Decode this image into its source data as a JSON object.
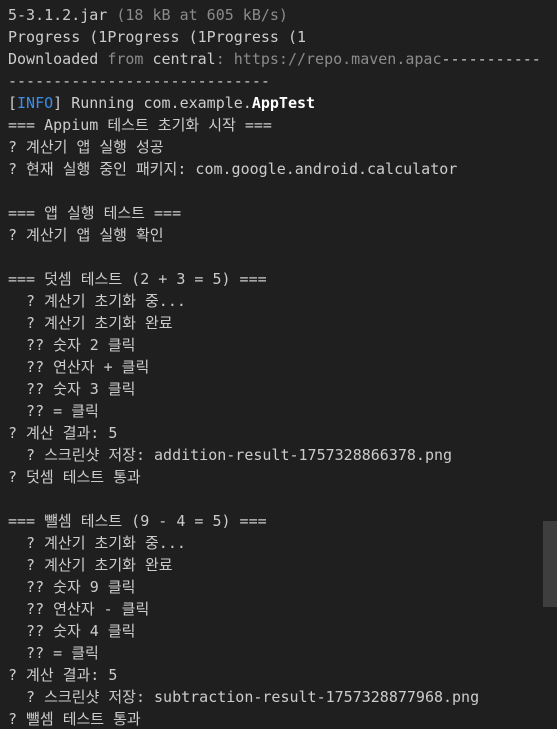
{
  "terminal": {
    "lines": [
      [
        {
          "t": "5-3.1.2.jar ",
          "c": "normal"
        },
        {
          "t": "(18 kB at 605 kB/s)",
          "c": "muted"
        }
      ],
      [
        {
          "t": "Progress (1Progress (1Progress (1",
          "c": "normal"
        }
      ],
      [
        {
          "t": "Downloaded ",
          "c": "normal"
        },
        {
          "t": "from ",
          "c": "muted"
        },
        {
          "t": "central",
          "c": "normal"
        },
        {
          "t": ": https://repo.maven.apac",
          "c": "muted"
        },
        {
          "t": "-----------",
          "c": "normal"
        }
      ],
      [
        {
          "t": "-----------------------------",
          "c": "normal"
        }
      ],
      [
        {
          "t": "[",
          "c": "normal"
        },
        {
          "t": "INFO",
          "c": "info"
        },
        {
          "t": "] Running com.example.",
          "c": "normal"
        },
        {
          "t": "AppTest",
          "c": "bold"
        }
      ],
      [
        {
          "t": "=== Appium 테스트 초기화 시작 ===",
          "c": "normal"
        }
      ],
      [
        {
          "t": "? 계산기 앱 실행 성공",
          "c": "normal"
        }
      ],
      [
        {
          "t": "? 현재 실행 중인 패키지: com.google.android.calculator",
          "c": "normal"
        }
      ],
      [
        {
          "t": "",
          "c": "normal"
        }
      ],
      [
        {
          "t": "=== 앱 실행 테스트 ===",
          "c": "normal"
        }
      ],
      [
        {
          "t": "? 계산기 앱 실행 확인",
          "c": "normal"
        }
      ],
      [
        {
          "t": "",
          "c": "normal"
        }
      ],
      [
        {
          "t": "=== 덧셈 테스트 (2 + 3 = 5) ===",
          "c": "normal"
        }
      ],
      [
        {
          "t": "  ? 계산기 초기화 중...",
          "c": "normal"
        }
      ],
      [
        {
          "t": "  ? 계산기 초기화 완료",
          "c": "normal"
        }
      ],
      [
        {
          "t": "  ?? 숫자 2 클릭",
          "c": "normal"
        }
      ],
      [
        {
          "t": "  ?? 연산자 + 클릭",
          "c": "normal"
        }
      ],
      [
        {
          "t": "  ?? 숫자 3 클릭",
          "c": "normal"
        }
      ],
      [
        {
          "t": "  ?? = 클릭",
          "c": "normal"
        }
      ],
      [
        {
          "t": "? 계산 결과: 5",
          "c": "normal"
        }
      ],
      [
        {
          "t": "  ? 스크린샷 저장: addition-result-1757328866378.png",
          "c": "normal"
        }
      ],
      [
        {
          "t": "? 덧셈 테스트 통과",
          "c": "normal"
        }
      ],
      [
        {
          "t": "",
          "c": "normal"
        }
      ],
      [
        {
          "t": "=== 뺄셈 테스트 (9 - 4 = 5) ===",
          "c": "normal"
        }
      ],
      [
        {
          "t": "  ? 계산기 초기화 중...",
          "c": "normal"
        }
      ],
      [
        {
          "t": "  ? 계산기 초기화 완료",
          "c": "normal"
        }
      ],
      [
        {
          "t": "  ?? 숫자 9 클릭",
          "c": "normal"
        }
      ],
      [
        {
          "t": "  ?? 연산자 - 클릭",
          "c": "normal"
        }
      ],
      [
        {
          "t": "  ?? 숫자 4 클릭",
          "c": "normal"
        }
      ],
      [
        {
          "t": "  ?? = 클릭",
          "c": "normal"
        }
      ],
      [
        {
          "t": "? 계산 결과: 5",
          "c": "normal"
        }
      ],
      [
        {
          "t": "  ? 스크린샷 저장: subtraction-result-1757328877968.png",
          "c": "normal"
        }
      ],
      [
        {
          "t": "? 뺄셈 테스트 통과",
          "c": "normal"
        }
      ]
    ]
  },
  "colors": {
    "background": "#1f1f1f",
    "text": "#cccccc",
    "muted": "#8b8b8b",
    "info": "#3b8eea",
    "bold": "#ffffff",
    "scrollbar_thumb": "#3e3e3e"
  }
}
